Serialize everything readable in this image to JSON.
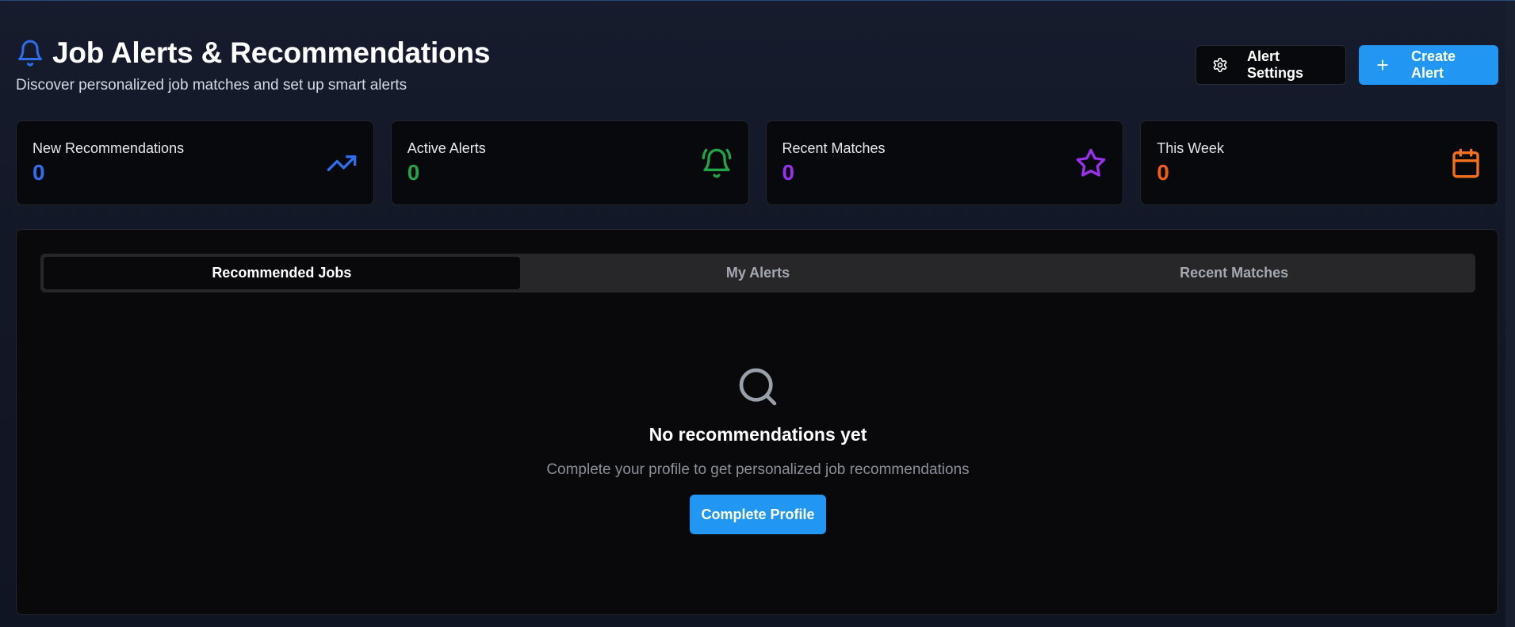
{
  "header": {
    "title": "Job Alerts & Recommendations",
    "subtitle": "Discover personalized job matches and set up smart alerts",
    "icon": "bell-icon",
    "actions": {
      "settings_label": "Alert Settings",
      "create_label": "Create Alert"
    }
  },
  "stats": [
    {
      "label": "New Recommendations",
      "value": "0",
      "color": "#2f6fed",
      "icon": "trending-up-icon"
    },
    {
      "label": "Active Alerts",
      "value": "0",
      "color": "#22a447",
      "icon": "bell-ring-icon"
    },
    {
      "label": "Recent Matches",
      "value": "0",
      "color": "#9a2ff0",
      "icon": "star-icon"
    },
    {
      "label": "This Week",
      "value": "0",
      "color": "#f25c14",
      "icon": "calendar-icon"
    }
  ],
  "tabs": [
    {
      "label": "Recommended Jobs",
      "active": true
    },
    {
      "label": "My Alerts",
      "active": false
    },
    {
      "label": "Recent Matches",
      "active": false
    }
  ],
  "empty_state": {
    "icon": "search-icon",
    "title": "No recommendations yet",
    "description": "Complete your profile to get personalized job recommendations",
    "button_label": "Complete Profile"
  },
  "colors": {
    "accent": "#2196f3",
    "background": "#121826",
    "card": "#08090c"
  }
}
